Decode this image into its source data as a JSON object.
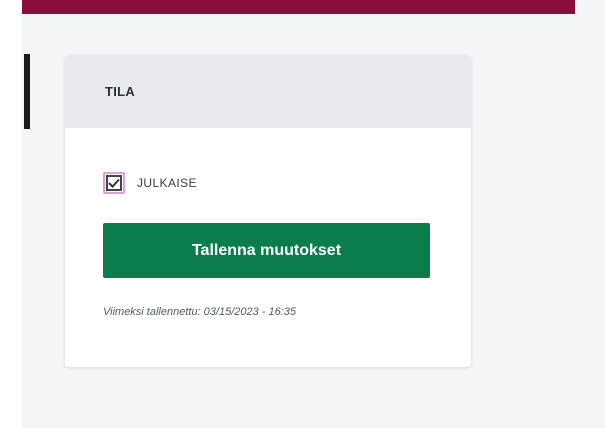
{
  "status_panel": {
    "title": "TILA",
    "publish_checkbox": {
      "label": "JULKAISE",
      "checked": true
    },
    "save_button_label": "Tallenna muutokset",
    "last_saved_text": "Viimeksi tallennettu: 03/15/2023 - 16:35"
  },
  "colors": {
    "top_bar": "#8b0d3b",
    "save_button": "#0b7d4c",
    "checkbox_focus": "#d7a4da"
  }
}
